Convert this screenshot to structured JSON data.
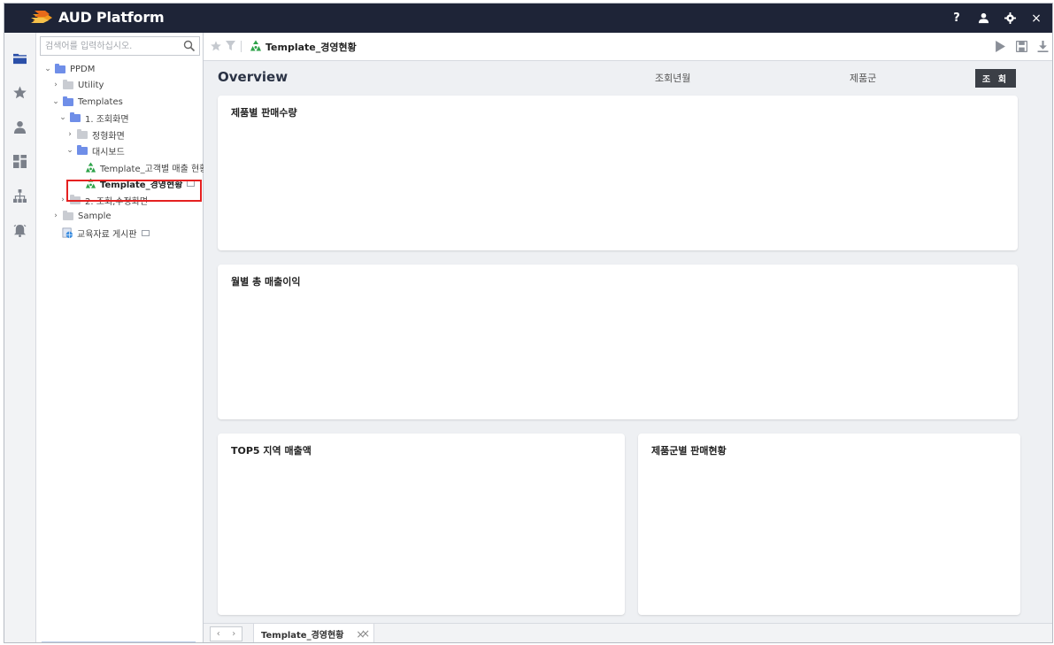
{
  "app": {
    "title": "AUD Platform",
    "help_glyph": "?",
    "close_glyph": "×"
  },
  "search": {
    "placeholder": "검색어를 입력하십시오."
  },
  "tree": {
    "root": "PPDM",
    "utility": "Utility",
    "templates": "Templates",
    "query_screens": "1. 조회화면",
    "fixed_screens": "정형화면",
    "dashboard": "대시보드",
    "template_customer_sales": "Template_고객별 매출 현황",
    "template_management": "Template_경영현황",
    "query_edit_screens": "2. 조회,수정화면",
    "sample": "Sample",
    "board": "교육자료 게시판"
  },
  "toolbar": {
    "doc_title": "Template_경영현황"
  },
  "filters": {
    "overview": "Overview",
    "month_label": "조회년월",
    "product_label": "제품군",
    "query_button": "조 회"
  },
  "cards": {
    "sales_qty": "제품별 판매수량",
    "monthly_profit": "월별 총 매출이익",
    "top5_region": "TOP5 지역 매출액",
    "product_group": "제품군별 판매현황"
  },
  "bottom": {
    "tab_label": "Template_경영현황",
    "tab_close": "×",
    "close_all": "×",
    "prev": "‹",
    "next": "›"
  },
  "colors": {
    "titlebar": "#1e2437",
    "accent": "#6f8ee8",
    "selection": "#e52121",
    "recycle_icon": "#2ea34a"
  }
}
